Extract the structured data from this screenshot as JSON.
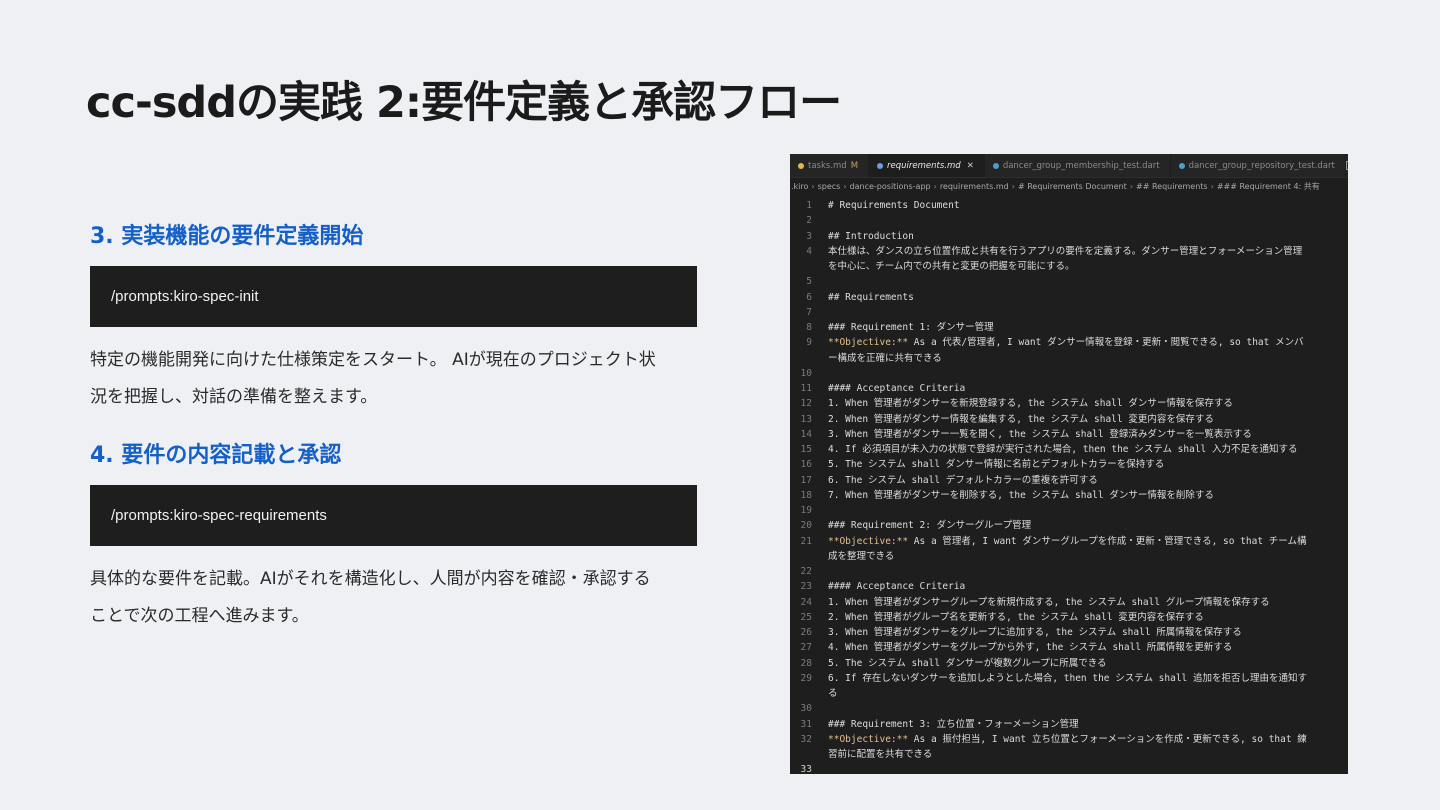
{
  "slide": {
    "title": "cc-sddの実践 2:要件定義と承認フロー"
  },
  "steps": [
    {
      "heading": "3. 実装機能の要件定義開始",
      "command": "/prompts:kiro-spec-init",
      "description_lines": [
        "特定の機能開発に向けた仕様策定をスタート。 AIが現在のプロジェクト状",
        "況を把握し、対話の準備を整えます。"
      ]
    },
    {
      "heading": "4. 要件の内容記載と承認",
      "command": "/prompts:kiro-spec-requirements",
      "description_lines": [
        "具体的な要件を記載。AIがそれを構造化し、人間が内容を確認・承認する",
        "ことで次の工程へ進みます。"
      ]
    }
  ],
  "editor": {
    "tabs": [
      {
        "label": "tasks.md",
        "modified": "M",
        "icon_color": "#e0b84c",
        "active": false,
        "close": ""
      },
      {
        "label": "requirements.md",
        "modified": "",
        "icon_color": "#6aa0e0",
        "active": true,
        "close": "✕"
      },
      {
        "label": "dancer_group_membership_test.dart",
        "modified": "",
        "icon_color": "#4aa0c8",
        "active": false,
        "close": ""
      },
      {
        "label": "dancer_group_repository_test.dart",
        "modified": "",
        "icon_color": "#4aa0c8",
        "active": false,
        "close": ""
      }
    ],
    "breadcrumb": [
      ".kiro",
      "specs",
      "dance-positions-app",
      "requirements.md",
      "# Requirements Document",
      "## Requirements",
      "### Requirement 4: 共有"
    ],
    "lines": [
      {
        "n": "1",
        "objective": "",
        "text": "# Requirements Document"
      },
      {
        "n": "2",
        "objective": "",
        "text": ""
      },
      {
        "n": "3",
        "objective": "",
        "text": "## Introduction"
      },
      {
        "n": "4",
        "objective": "",
        "text": "本仕様は、ダンスの立ち位置作成と共有を行うアプリの要件を定義する。ダンサー管理とフォーメーション管理"
      },
      {
        "n": "",
        "objective": "",
        "text": "を中心に、チーム内での共有と変更の把握を可能にする。"
      },
      {
        "n": "5",
        "objective": "",
        "text": ""
      },
      {
        "n": "6",
        "objective": "",
        "text": "## Requirements"
      },
      {
        "n": "7",
        "objective": "",
        "text": ""
      },
      {
        "n": "8",
        "objective": "",
        "text": "### Requirement 1: ダンサー管理"
      },
      {
        "n": "9",
        "objective": "**Objective:**",
        "text": " As a 代表/管理者, I want ダンサー情報を登録・更新・閲覧できる, so that メンバ"
      },
      {
        "n": "",
        "objective": "",
        "text": "ー構成を正確に共有できる"
      },
      {
        "n": "10",
        "objective": "",
        "text": ""
      },
      {
        "n": "11",
        "objective": "",
        "text": "#### Acceptance Criteria"
      },
      {
        "n": "12",
        "objective": "",
        "text": "1. When 管理者がダンサーを新規登録する, the システム shall ダンサー情報を保存する"
      },
      {
        "n": "13",
        "objective": "",
        "text": "2. When 管理者がダンサー情報を編集する, the システム shall 変更内容を保存する"
      },
      {
        "n": "14",
        "objective": "",
        "text": "3. When 管理者がダンサー一覧を開く, the システム shall 登録済みダンサーを一覧表示する"
      },
      {
        "n": "15",
        "objective": "",
        "text": "4. If 必須項目が未入力の状態で登録が実行された場合, then the システム shall 入力不足を通知する"
      },
      {
        "n": "16",
        "objective": "",
        "text": "5. The システム shall ダンサー情報に名前とデフォルトカラーを保持する"
      },
      {
        "n": "17",
        "objective": "",
        "text": "6. The システム shall デフォルトカラーの重複を許可する"
      },
      {
        "n": "18",
        "objective": "",
        "text": "7. When 管理者がダンサーを削除する, the システム shall ダンサー情報を削除する"
      },
      {
        "n": "19",
        "objective": "",
        "text": ""
      },
      {
        "n": "20",
        "objective": "",
        "text": "### Requirement 2: ダンサーグループ管理"
      },
      {
        "n": "21",
        "objective": "**Objective:**",
        "text": " As a 管理者, I want ダンサーグループを作成・更新・管理できる, so that チーム構"
      },
      {
        "n": "",
        "objective": "",
        "text": "成を整理できる"
      },
      {
        "n": "22",
        "objective": "",
        "text": ""
      },
      {
        "n": "23",
        "objective": "",
        "text": "#### Acceptance Criteria"
      },
      {
        "n": "24",
        "objective": "",
        "text": "1. When 管理者がダンサーグループを新規作成する, the システム shall グループ情報を保存する"
      },
      {
        "n": "25",
        "objective": "",
        "text": "2. When 管理者がグループ名を更新する, the システム shall 変更内容を保存する"
      },
      {
        "n": "26",
        "objective": "",
        "text": "3. When 管理者がダンサーをグループに追加する, the システム shall 所属情報を保存する"
      },
      {
        "n": "27",
        "objective": "",
        "text": "4. When 管理者がダンサーをグループから外す, the システム shall 所属情報を更新する"
      },
      {
        "n": "28",
        "objective": "",
        "text": "5. The システム shall ダンサーが複数グループに所属できる"
      },
      {
        "n": "29",
        "objective": "",
        "text": "6. If 存在しないダンサーを追加しようとした場合, then the システム shall 追加を拒否し理由を通知す"
      },
      {
        "n": "",
        "objective": "",
        "text": "る"
      },
      {
        "n": "30",
        "objective": "",
        "text": ""
      },
      {
        "n": "31",
        "objective": "",
        "text": "### Requirement 3: 立ち位置・フォーメーション管理"
      },
      {
        "n": "32",
        "objective": "**Objective:**",
        "text": " As a 振付担当, I want 立ち位置とフォーメーションを作成・更新できる, so that 練"
      },
      {
        "n": "",
        "objective": "",
        "text": "習前に配置を共有できる"
      },
      {
        "n": "33",
        "objective": "",
        "text": ""
      }
    ]
  }
}
